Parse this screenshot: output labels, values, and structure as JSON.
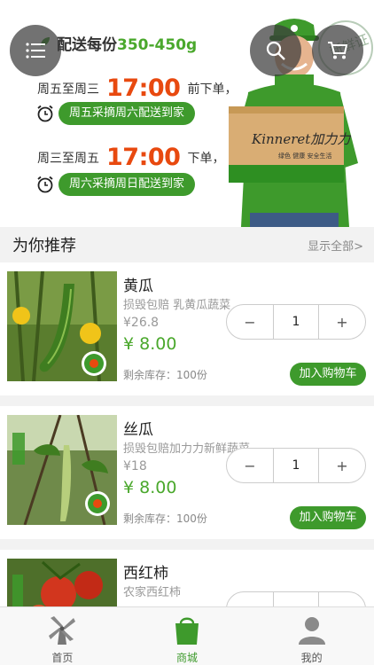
{
  "banner": {
    "title_prefix": "配送每份",
    "title_range": "350-450g",
    "line1_pre": "周五至周三",
    "line1_time": "17:00",
    "line1_post": "前下单，",
    "pill1": "周五采摘周六配送到家",
    "line2_pre": "周三至周五",
    "line2_time": "17:00",
    "line2_post": "下单，",
    "pill2": "周六采摘周日配送到家",
    "box_brand": "Kinneret加力力",
    "box_slogan": "绿色  健康  安全生活",
    "stamp_text": "新鲜证"
  },
  "recommend": {
    "title": "为你推荐",
    "show_all": "显示全部>"
  },
  "products": [
    {
      "name": "黄瓜",
      "desc": "损毁包赔 乳黄瓜蔬菜",
      "orig_price": "¥26.8",
      "price": "¥ 8.00",
      "qty": "1",
      "stock": "剩余库存：100份",
      "add_label": "加入购物车"
    },
    {
      "name": "丝瓜",
      "desc": "损毁包赔加力力新鲜蔬菜",
      "orig_price": "¥18",
      "price": "¥ 8.00",
      "qty": "1",
      "stock": "剩余库存：100份",
      "add_label": "加入购物车"
    },
    {
      "name": "西红柿",
      "desc": "农家西红柿",
      "orig_price": "",
      "price": "",
      "qty": "",
      "stock": "",
      "add_label": ""
    }
  ],
  "stepper": {
    "minus": "−",
    "plus": "+"
  },
  "tabs": [
    {
      "label": "首页",
      "icon": "windmill-icon"
    },
    {
      "label": "商城",
      "icon": "shopping-bag-icon"
    },
    {
      "label": "我的",
      "icon": "user-icon"
    }
  ],
  "colors": {
    "accent": "#3e9a2c",
    "price": "#4aa82c",
    "time": "#e8490f"
  }
}
